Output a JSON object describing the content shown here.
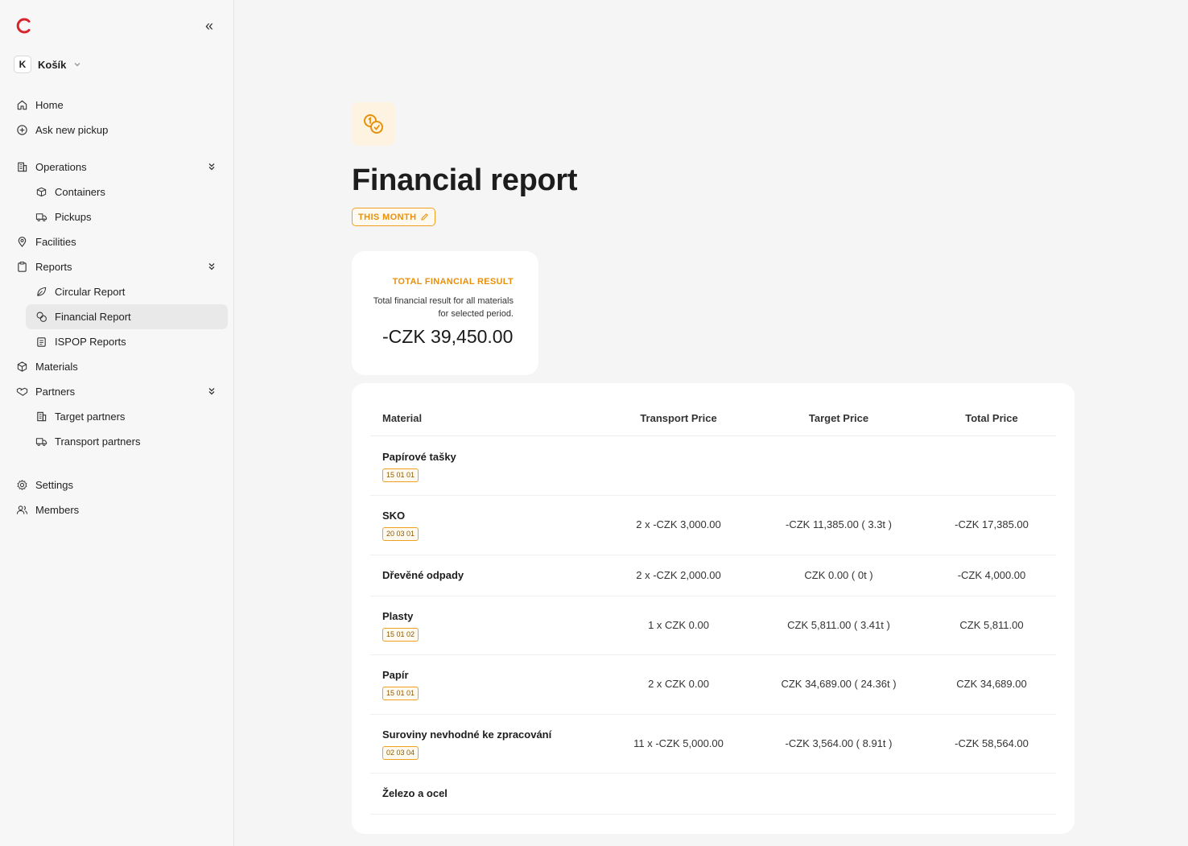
{
  "sidebar": {
    "org_initial": "K",
    "org_name": "Košík",
    "items": {
      "home": "Home",
      "ask_pickup": "Ask new pickup",
      "operations": "Operations",
      "containers": "Containers",
      "pickups": "Pickups",
      "facilities": "Facilities",
      "reports": "Reports",
      "circular_report": "Circular Report",
      "financial_report": "Financial Report",
      "ispop_reports": "ISPOP Reports",
      "materials": "Materials",
      "partners": "Partners",
      "target_partners": "Target partners",
      "transport_partners": "Transport partners",
      "settings": "Settings",
      "members": "Members"
    },
    "active_item": "financial_report"
  },
  "main": {
    "title": "Financial report",
    "period": "THIS MONTH",
    "summary": {
      "label": "TOTAL FINANCIAL RESULT",
      "description": "Total financial result for all materials for selected period.",
      "value": "-CZK 39,450.00"
    },
    "table": {
      "headers": {
        "material": "Material",
        "transport": "Transport Price",
        "target": "Target Price",
        "total": "Total Price"
      },
      "rows": [
        {
          "material": "Papírové tašky",
          "code": "15 01 01",
          "transport": "",
          "target": "",
          "total": ""
        },
        {
          "material": "SKO",
          "code": "20 03 01",
          "transport": "2 x -CZK 3,000.00",
          "target": "-CZK 11,385.00 ( 3.3t )",
          "total": "-CZK 17,385.00"
        },
        {
          "material": "Dřevěné odpady",
          "code": "",
          "transport": "2 x -CZK 2,000.00",
          "target": "CZK 0.00 ( 0t )",
          "total": "-CZK 4,000.00"
        },
        {
          "material": "Plasty",
          "code": "15 01 02",
          "transport": "1 x CZK 0.00",
          "target": "CZK 5,811.00 ( 3.41t )",
          "total": "CZK 5,811.00"
        },
        {
          "material": "Papír",
          "code": "15 01 01",
          "transport": "2 x CZK 0.00",
          "target": "CZK 34,689.00 ( 24.36t )",
          "total": "CZK 34,689.00"
        },
        {
          "material": "Suroviny nevhodné ke zpracování",
          "code": "02 03 04",
          "transport": "11 x -CZK 5,000.00",
          "target": "-CZK 3,564.00 ( 8.91t )",
          "total": "-CZK 58,564.00"
        },
        {
          "material": "Železo a ocel",
          "code": "",
          "transport": "",
          "target": "",
          "total": ""
        }
      ]
    }
  },
  "colors": {
    "accent": "#e8900c",
    "brand": "#d8232a",
    "active_bg": "#e9e9e9"
  }
}
